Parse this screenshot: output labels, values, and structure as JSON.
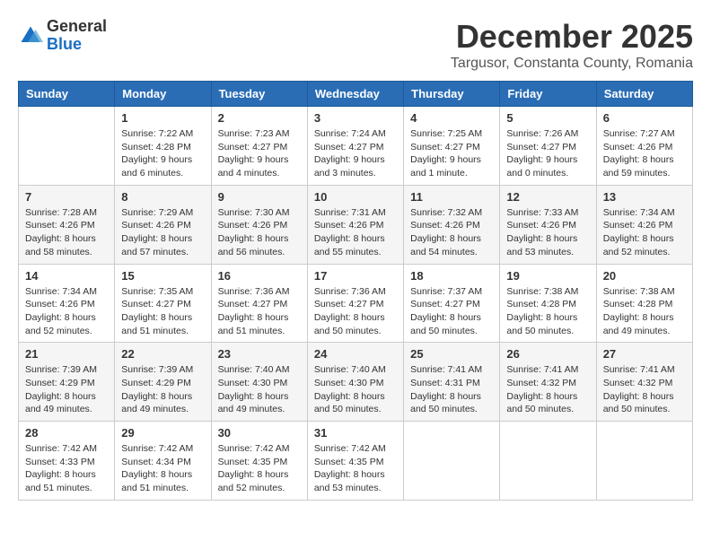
{
  "logo": {
    "general": "General",
    "blue": "Blue"
  },
  "title": "December 2025",
  "location": "Targusor, Constanta County, Romania",
  "days_header": [
    "Sunday",
    "Monday",
    "Tuesday",
    "Wednesday",
    "Thursday",
    "Friday",
    "Saturday"
  ],
  "weeks": [
    [
      {
        "day": "",
        "info": ""
      },
      {
        "day": "1",
        "info": "Sunrise: 7:22 AM\nSunset: 4:28 PM\nDaylight: 9 hours\nand 6 minutes."
      },
      {
        "day": "2",
        "info": "Sunrise: 7:23 AM\nSunset: 4:27 PM\nDaylight: 9 hours\nand 4 minutes."
      },
      {
        "day": "3",
        "info": "Sunrise: 7:24 AM\nSunset: 4:27 PM\nDaylight: 9 hours\nand 3 minutes."
      },
      {
        "day": "4",
        "info": "Sunrise: 7:25 AM\nSunset: 4:27 PM\nDaylight: 9 hours\nand 1 minute."
      },
      {
        "day": "5",
        "info": "Sunrise: 7:26 AM\nSunset: 4:27 PM\nDaylight: 9 hours\nand 0 minutes."
      },
      {
        "day": "6",
        "info": "Sunrise: 7:27 AM\nSunset: 4:26 PM\nDaylight: 8 hours\nand 59 minutes."
      }
    ],
    [
      {
        "day": "7",
        "info": "Sunrise: 7:28 AM\nSunset: 4:26 PM\nDaylight: 8 hours\nand 58 minutes."
      },
      {
        "day": "8",
        "info": "Sunrise: 7:29 AM\nSunset: 4:26 PM\nDaylight: 8 hours\nand 57 minutes."
      },
      {
        "day": "9",
        "info": "Sunrise: 7:30 AM\nSunset: 4:26 PM\nDaylight: 8 hours\nand 56 minutes."
      },
      {
        "day": "10",
        "info": "Sunrise: 7:31 AM\nSunset: 4:26 PM\nDaylight: 8 hours\nand 55 minutes."
      },
      {
        "day": "11",
        "info": "Sunrise: 7:32 AM\nSunset: 4:26 PM\nDaylight: 8 hours\nand 54 minutes."
      },
      {
        "day": "12",
        "info": "Sunrise: 7:33 AM\nSunset: 4:26 PM\nDaylight: 8 hours\nand 53 minutes."
      },
      {
        "day": "13",
        "info": "Sunrise: 7:34 AM\nSunset: 4:26 PM\nDaylight: 8 hours\nand 52 minutes."
      }
    ],
    [
      {
        "day": "14",
        "info": "Sunrise: 7:34 AM\nSunset: 4:26 PM\nDaylight: 8 hours\nand 52 minutes."
      },
      {
        "day": "15",
        "info": "Sunrise: 7:35 AM\nSunset: 4:27 PM\nDaylight: 8 hours\nand 51 minutes."
      },
      {
        "day": "16",
        "info": "Sunrise: 7:36 AM\nSunset: 4:27 PM\nDaylight: 8 hours\nand 51 minutes."
      },
      {
        "day": "17",
        "info": "Sunrise: 7:36 AM\nSunset: 4:27 PM\nDaylight: 8 hours\nand 50 minutes."
      },
      {
        "day": "18",
        "info": "Sunrise: 7:37 AM\nSunset: 4:27 PM\nDaylight: 8 hours\nand 50 minutes."
      },
      {
        "day": "19",
        "info": "Sunrise: 7:38 AM\nSunset: 4:28 PM\nDaylight: 8 hours\nand 50 minutes."
      },
      {
        "day": "20",
        "info": "Sunrise: 7:38 AM\nSunset: 4:28 PM\nDaylight: 8 hours\nand 49 minutes."
      }
    ],
    [
      {
        "day": "21",
        "info": "Sunrise: 7:39 AM\nSunset: 4:29 PM\nDaylight: 8 hours\nand 49 minutes."
      },
      {
        "day": "22",
        "info": "Sunrise: 7:39 AM\nSunset: 4:29 PM\nDaylight: 8 hours\nand 49 minutes."
      },
      {
        "day": "23",
        "info": "Sunrise: 7:40 AM\nSunset: 4:30 PM\nDaylight: 8 hours\nand 49 minutes."
      },
      {
        "day": "24",
        "info": "Sunrise: 7:40 AM\nSunset: 4:30 PM\nDaylight: 8 hours\nand 50 minutes."
      },
      {
        "day": "25",
        "info": "Sunrise: 7:41 AM\nSunset: 4:31 PM\nDaylight: 8 hours\nand 50 minutes."
      },
      {
        "day": "26",
        "info": "Sunrise: 7:41 AM\nSunset: 4:32 PM\nDaylight: 8 hours\nand 50 minutes."
      },
      {
        "day": "27",
        "info": "Sunrise: 7:41 AM\nSunset: 4:32 PM\nDaylight: 8 hours\nand 50 minutes."
      }
    ],
    [
      {
        "day": "28",
        "info": "Sunrise: 7:42 AM\nSunset: 4:33 PM\nDaylight: 8 hours\nand 51 minutes."
      },
      {
        "day": "29",
        "info": "Sunrise: 7:42 AM\nSunset: 4:34 PM\nDaylight: 8 hours\nand 51 minutes."
      },
      {
        "day": "30",
        "info": "Sunrise: 7:42 AM\nSunset: 4:35 PM\nDaylight: 8 hours\nand 52 minutes."
      },
      {
        "day": "31",
        "info": "Sunrise: 7:42 AM\nSunset: 4:35 PM\nDaylight: 8 hours\nand 53 minutes."
      },
      {
        "day": "",
        "info": ""
      },
      {
        "day": "",
        "info": ""
      },
      {
        "day": "",
        "info": ""
      }
    ]
  ]
}
